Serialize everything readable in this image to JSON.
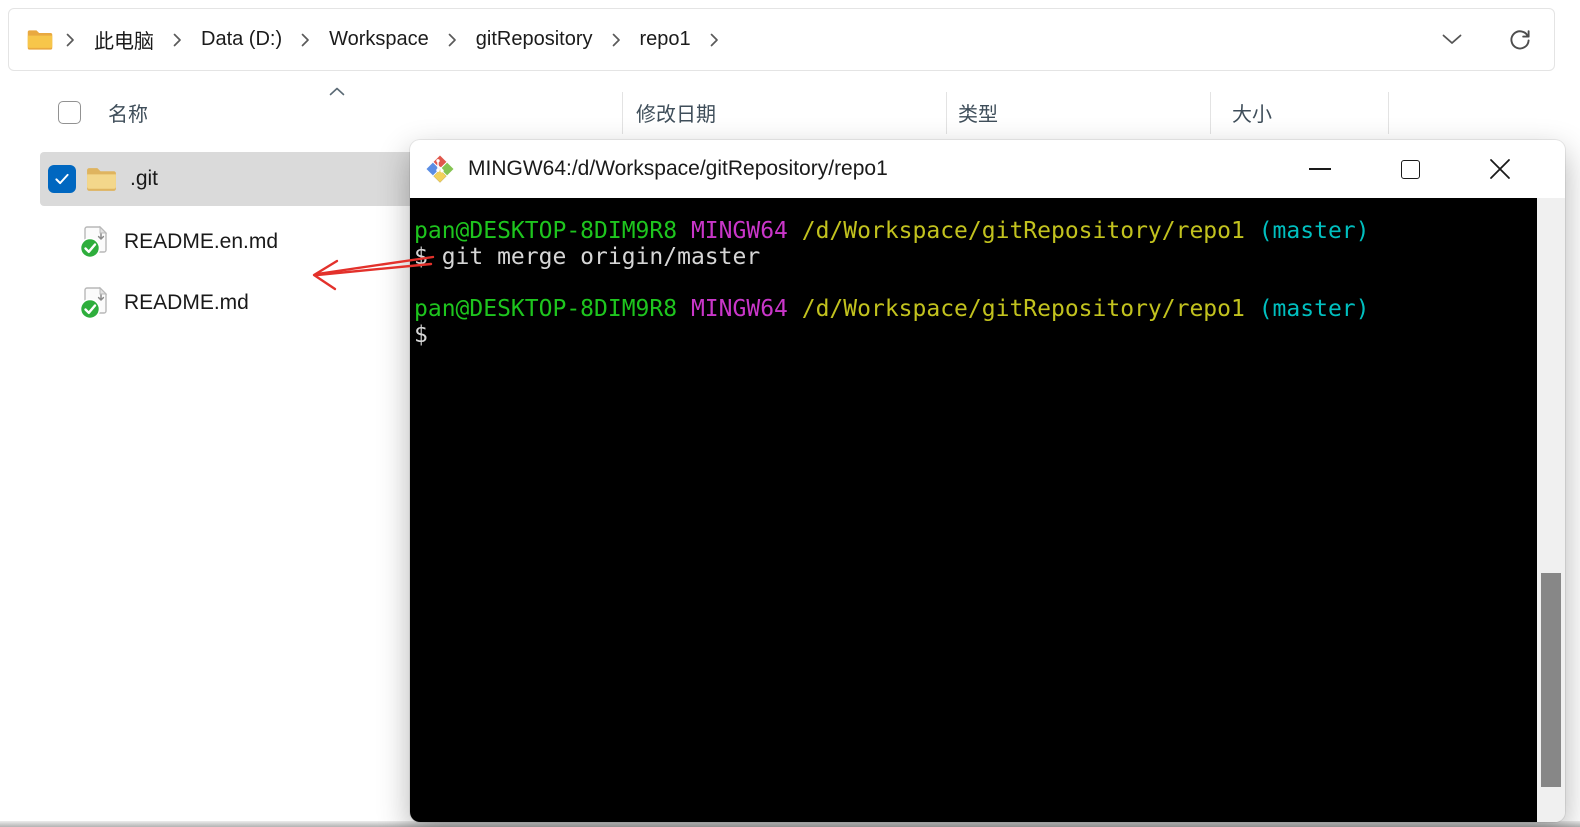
{
  "colors": {
    "accent_blue": "#0067c0",
    "selection_gray": "#dadada",
    "terminal_bg": "#000000",
    "terminal_green": "#1ec51e",
    "terminal_magenta": "#c936c9",
    "terminal_yellow": "#c2c21e",
    "terminal_cyan": "#00bfbf",
    "terminal_fg": "#d6d6d6",
    "annotation_arrow_red": "#e3312b"
  },
  "explorer": {
    "address_bar": {
      "breadcrumb": [
        "此电脑",
        "Data (D:)",
        "Workspace",
        "gitRepository",
        "repo1"
      ],
      "icons": {
        "location": "folder-icon",
        "separator": "chevron-right-icon",
        "dropdown": "chevron-down-icon",
        "refresh": "refresh-icon"
      }
    },
    "list_header": {
      "columns": [
        "名称",
        "修改日期",
        "类型",
        "大小"
      ],
      "sort_indicator": "chevron-up-icon",
      "select_all_checked": false
    },
    "files": [
      {
        "name": ".git",
        "kind": "folder",
        "checked": true
      },
      {
        "name": "README.en.md",
        "kind": "markdown-file-committed"
      },
      {
        "name": "README.md",
        "kind": "markdown-file-committed"
      }
    ]
  },
  "terminal": {
    "title": "MINGW64:/d/Workspace/gitRepository/repo1",
    "app_icon": "git-mintty-icon",
    "controls": [
      "minimize-icon",
      "maximize-icon",
      "close-icon"
    ],
    "scrolled_to_bottom": true,
    "lines": [
      {
        "segs": [
          {
            "t": "pan@DESKTOP-8DIM9R8 ",
            "c": "green"
          },
          {
            "t": "MINGW64 ",
            "c": "magenta"
          },
          {
            "t": "/d/Workspace/gitRepository/repo1 ",
            "c": "yellow"
          },
          {
            "t": "(master)",
            "c": "cyan"
          }
        ]
      },
      {
        "segs": [
          {
            "t": "$ git merge origin/master",
            "c": "default"
          }
        ]
      },
      {
        "segs": []
      },
      {
        "segs": [
          {
            "t": "pan@DESKTOP-8DIM9R8 ",
            "c": "green"
          },
          {
            "t": "MINGW64 ",
            "c": "magenta"
          },
          {
            "t": "/d/Workspace/gitRepository/repo1 ",
            "c": "yellow"
          },
          {
            "t": "(master)",
            "c": "cyan"
          }
        ]
      },
      {
        "segs": [
          {
            "t": "$",
            "c": "default"
          }
        ]
      }
    ]
  }
}
